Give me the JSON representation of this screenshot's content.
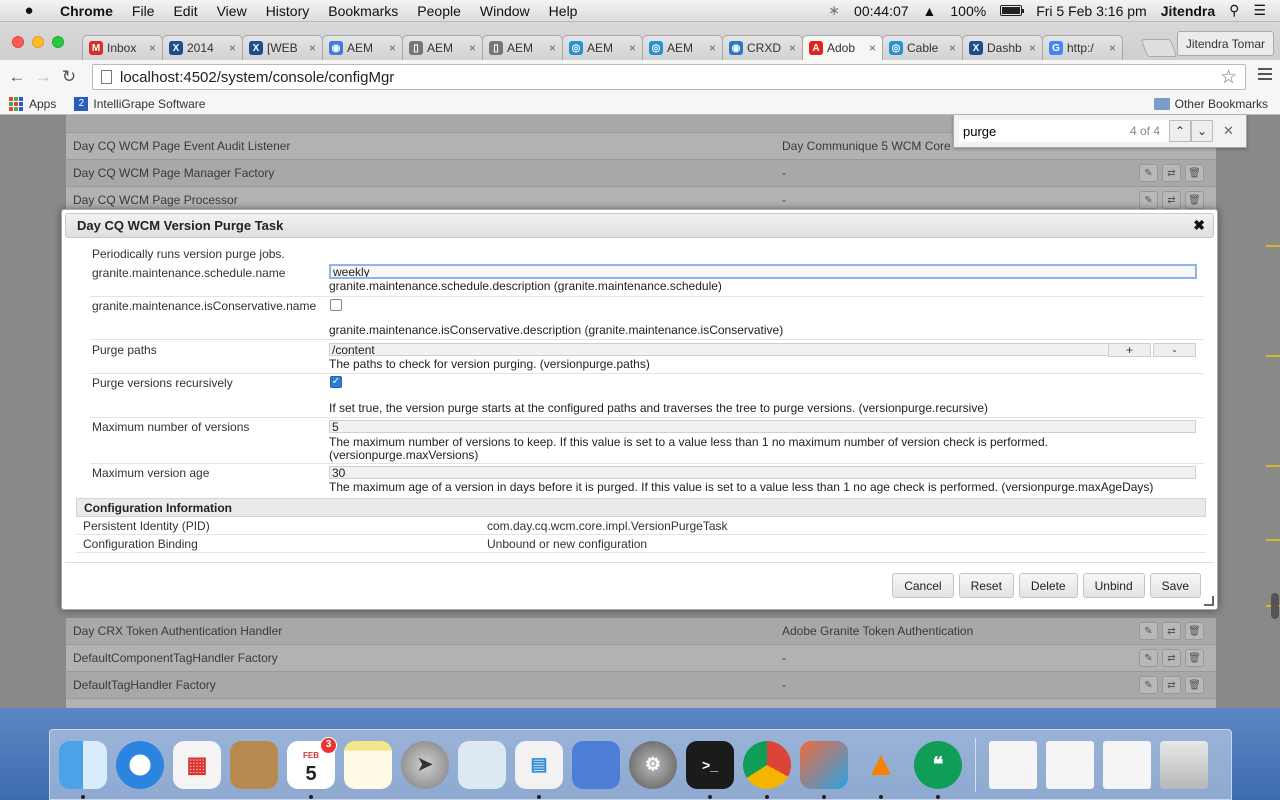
{
  "menubar": {
    "apple": "",
    "items": [
      "Chrome",
      "File",
      "Edit",
      "View",
      "History",
      "Bookmarks",
      "People",
      "Window",
      "Help"
    ],
    "time_elapsed": "00:44:07",
    "battery": "100%",
    "datetime": "Fri 5 Feb  3:16 pm",
    "user": "Jitendra"
  },
  "browser": {
    "tabs": [
      {
        "label": "Inbox",
        "fav": "M",
        "color": "#d93025"
      },
      {
        "label": "2014",
        "fav": "X",
        "color": "#1f4e8c"
      },
      {
        "label": "[WEB",
        "fav": "X",
        "color": "#1f4e8c"
      },
      {
        "label": "AEM",
        "fav": "◉",
        "color": "#3b7dd8"
      },
      {
        "label": "AEM",
        "fav": "▯",
        "color": "#777777"
      },
      {
        "label": "AEM",
        "fav": "▯",
        "color": "#777777"
      },
      {
        "label": "AEM",
        "fav": "◎",
        "color": "#2b8fd6"
      },
      {
        "label": "AEM",
        "fav": "◎",
        "color": "#2b8fd6"
      },
      {
        "label": "CRXD",
        "fav": "◉",
        "color": "#2b7bc4"
      },
      {
        "label": "Adob",
        "fav": "A",
        "color": "#e2231a"
      },
      {
        "label": "Cable",
        "fav": "◎",
        "color": "#2b8fd6"
      },
      {
        "label": "Dashb",
        "fav": "X",
        "color": "#1f4e8c"
      },
      {
        "label": "http:/",
        "fav": "G",
        "color": "#4285f4"
      }
    ],
    "active_tab": 9,
    "profile": "Jitendra Tomar",
    "url": "localhost:4502/system/console/configMgr",
    "bookmarks": {
      "apps": "Apps",
      "item2": "IntelliGrape Software",
      "other": "Other Bookmarks"
    }
  },
  "findbar": {
    "query": "purge",
    "count": "4 of 4"
  },
  "background_rows": [
    {
      "name": "Day CQ WCM Page Event Audit Listener",
      "bundle": "Day Communique 5 WCM Core"
    },
    {
      "name": "Day CQ WCM Page Manager Factory",
      "bundle": "-"
    },
    {
      "name": "Day CQ WCM Page Processor",
      "bundle": "-"
    },
    {
      "name": "Day CRX Token Authentication Handler",
      "bundle": "Adobe Granite Token Authentication"
    },
    {
      "name": "DefaultComponentTagHandler Factory",
      "bundle": "-"
    },
    {
      "name": "DefaultTagHandler Factory",
      "bundle": "-"
    }
  ],
  "dialog": {
    "title": "Day CQ WCM Version Purge Task",
    "close": "✖",
    "description": "Periodically runs version purge jobs.",
    "props": {
      "schedule": {
        "label": "granite.maintenance.schedule.name",
        "value": "weekly",
        "desc": "granite.maintenance.schedule.description (granite.maintenance.schedule)"
      },
      "conservative": {
        "label": "granite.maintenance.isConservative.name",
        "checked": false,
        "desc": "granite.maintenance.isConservative.description (granite.maintenance.isConservative)"
      },
      "paths": {
        "label": "Purge paths",
        "value": "/content",
        "plus": "+",
        "minus": "-",
        "desc": "The paths to check for version purging. (versionpurge.paths)"
      },
      "recursive": {
        "label": "Purge versions recursively",
        "checked": true,
        "desc": "If set true, the version purge starts at the configured paths and traverses the tree to purge versions. (versionpurge.recursive)"
      },
      "maxversions": {
        "label": "Maximum number of versions",
        "value": "5",
        "desc1": "The maximum number of versions to keep. If this value is set to a value less than 1 no maximum number of version check is performed.",
        "desc2": "(versionpurge.maxVersions)"
      },
      "maxage": {
        "label": "Maximum version age",
        "value": "30",
        "desc": "The maximum age of a version in days before it is purged. If this value is set to a value less than 1 no age check is performed. (versionpurge.maxAgeDays)"
      }
    },
    "config_info": {
      "heading": "Configuration Information",
      "pid_label": "Persistent Identity (PID)",
      "pid_value": "com.day.cq.wcm.core.impl.VersionPurgeTask",
      "binding_label": "Configuration Binding",
      "binding_value": "Unbound or new configuration"
    },
    "buttons": {
      "cancel": "Cancel",
      "reset": "Reset",
      "delete": "Delete",
      "unbind": "Unbind",
      "save": "Save"
    }
  },
  "dock": {
    "calendar_month": "FEB",
    "calendar_day": "5",
    "calendar_badge": "3"
  }
}
